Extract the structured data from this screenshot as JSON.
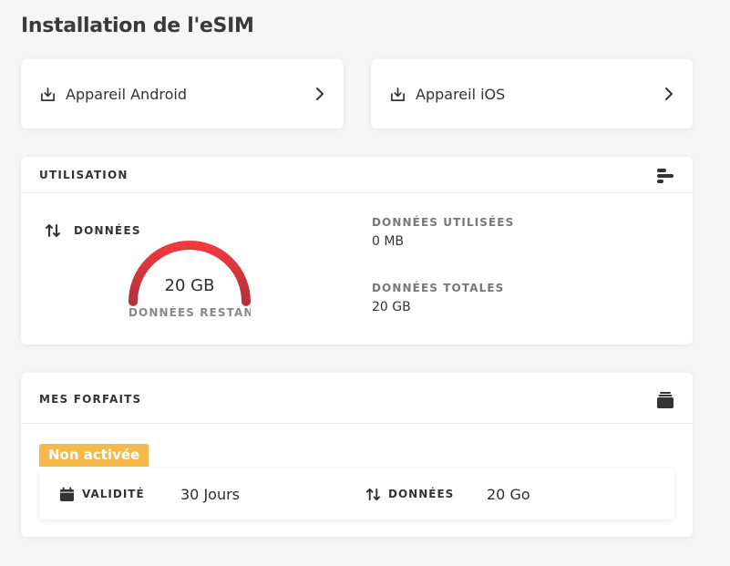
{
  "page": {
    "title": "Installation de l'eSIM"
  },
  "devices": [
    {
      "label": "Appareil Android",
      "icon": "download-icon"
    },
    {
      "label": "Appareil iOS",
      "icon": "download-icon"
    }
  ],
  "usage": {
    "header": "UTILISATION",
    "data_label": "DONNÉES",
    "remaining_value": "20 GB",
    "remaining_label": "DONNÉES RESTANTES",
    "remaining_fraction": 1.0,
    "used_label": "DONNÉES UTILISÉES",
    "used_value": "0 MB",
    "total_label": "DONNÉES TOTALES",
    "total_value": "20 GB",
    "gauge_colors": {
      "start": "#b3313f",
      "end": "#f03a3f"
    }
  },
  "plans": {
    "header": "MES FORFAITS",
    "badge": "Non activée",
    "badge_color": "#f5b84a",
    "items": [
      {
        "label": "VALIDITÉ",
        "value": "30 Jours",
        "icon": "calendar-icon"
      },
      {
        "label": "DONNÉES",
        "value": "20 Go",
        "icon": "up-down-arrows-icon"
      }
    ]
  }
}
